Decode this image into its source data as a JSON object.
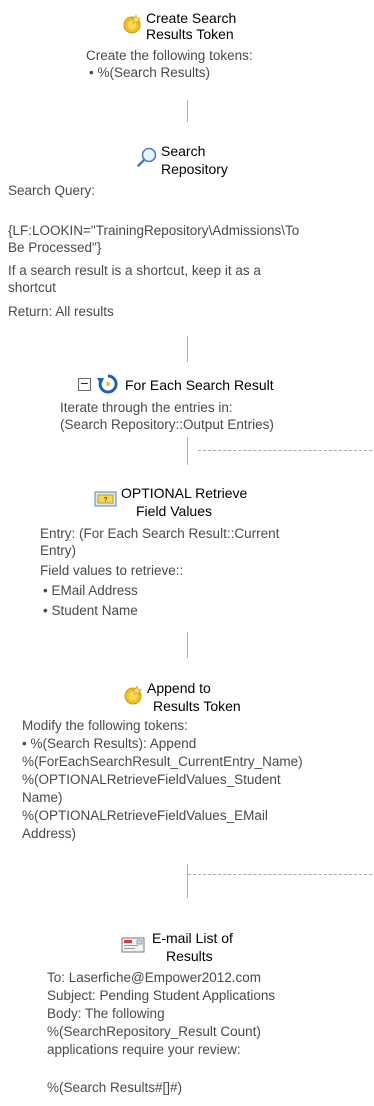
{
  "steps": {
    "create_token": {
      "title_line1": "Create Search",
      "title_line2": "Results Token",
      "details": [
        "Create the following tokens:",
        "• %(Search Results)"
      ]
    },
    "search_repo": {
      "title_line1": "Search",
      "title_line2": "Repository",
      "details": [
        "Search Query:",
        "",
        "{LF:LOOKIN=\"TrainingRepository\\Admissions\\To",
        "Be Processed\"}",
        "If a search result is a shortcut, keep it as a",
        "shortcut",
        "Return: All results"
      ]
    },
    "for_each": {
      "collapse_glyph": "−",
      "title": "For Each Search Result",
      "details": [
        "Iterate through the entries in:",
        "(Search Repository::Output Entries)"
      ]
    },
    "retrieve": {
      "title_line1": "OPTIONAL Retrieve",
      "title_line2": "Field Values",
      "details": [
        "Entry: (For Each Search Result::Current",
        "Entry)",
        "Field values to retrieve::",
        "• EMail Address",
        "• Student Name"
      ]
    },
    "append": {
      "title_line1": "Append to",
      "title_line2": "Results Token",
      "details": [
        "Modify the following tokens:",
        "• %(Search Results): Append",
        "%(ForEachSearchResult_CurrentEntry_Name)",
        "%(OPTIONALRetrieveFieldValues_Student",
        "Name)",
        "%(OPTIONALRetrieveFieldValues_EMail",
        "Address)"
      ]
    },
    "email": {
      "title_line1": "E-mail List of",
      "title_line2": "Results",
      "details": [
        "To: Laserfiche@Empower2012.com",
        "Subject: Pending Student Applications",
        "Body: The following",
        "%(SearchRepository_Result Count)",
        "applications require your review:",
        "",
        "%(Search Results#[]#)"
      ]
    }
  },
  "colors": {
    "title": "#000000",
    "detail": "#4a4a4a",
    "connector": "#b0b0b0",
    "token_icon": "#f2c21b",
    "search_icon": "#4a7fc0",
    "loop_icon": "#1f5fbf"
  },
  "icons": {
    "create_token": "token-icon",
    "search_repo": "magnifier-icon",
    "for_each": "loop-arrow-icon",
    "retrieve": "field-values-icon",
    "append": "token-icon",
    "email": "email-icon"
  }
}
